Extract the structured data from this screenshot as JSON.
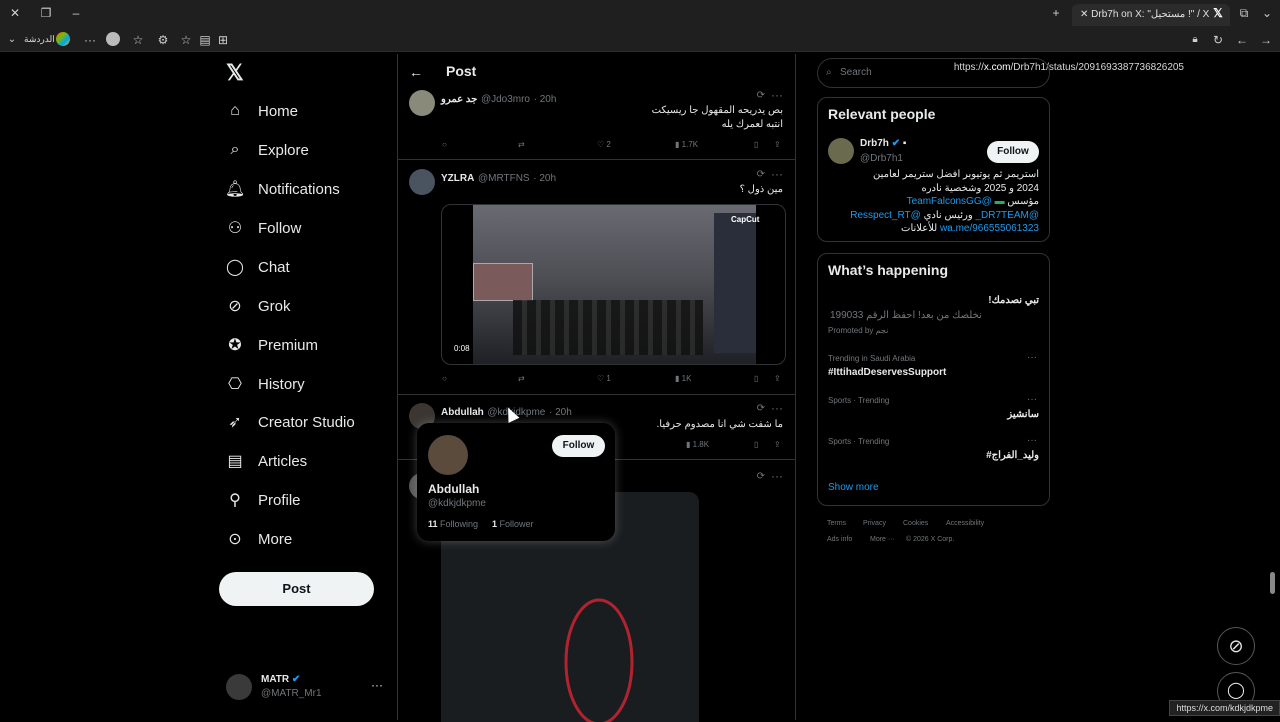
{
  "browser": {
    "tab_title": "Drb7h on X: \"مستحيل !\" / X",
    "url_prefix": "https://",
    "url_domain": "x.com",
    "url_path": "/Drb7h1/status/2091693387736826205",
    "left_chat_label": "الدردشة",
    "status_url": "https://x.com/kdkjdkpme"
  },
  "nav": {
    "items": [
      {
        "label": "Home",
        "icon": "home-icon"
      },
      {
        "label": "Explore",
        "icon": "search-icon"
      },
      {
        "label": "Notifications",
        "icon": "bell-icon"
      },
      {
        "label": "Follow",
        "icon": "person-add-icon"
      },
      {
        "label": "Chat",
        "icon": "chat-bubble-icon"
      },
      {
        "label": "Grok",
        "icon": "grok-icon"
      },
      {
        "label": "Premium",
        "icon": "verified-badge-icon"
      },
      {
        "label": "History",
        "icon": "bookmark-icon"
      },
      {
        "label": "Creator Studio",
        "icon": "rocket-icon"
      },
      {
        "label": "Articles",
        "icon": "articles-icon"
      },
      {
        "label": "Profile",
        "icon": "person-icon"
      },
      {
        "label": "More",
        "icon": "more-circle-icon"
      }
    ],
    "post_label": "Post",
    "account": {
      "name": "MATR",
      "handle": "@MATR_Mr1"
    }
  },
  "header": {
    "title": "Post"
  },
  "tweets": [
    {
      "name": "جد عمرو",
      "handle": "@Jdo3mro",
      "time": "· 20h",
      "line1": "بص يدريحه المقهول جا ريسيكت",
      "line2": "انتبه لعمرك يله",
      "likes": "2",
      "views": "1.7K"
    },
    {
      "name": "YZLRA",
      "handle": "@MRTFNS",
      "time": "· 20h",
      "line1": "مين ذول ؟",
      "video_time": "0:08",
      "watermark": "CapCut",
      "likes": "1",
      "views": "1K"
    },
    {
      "name": "Abdullah",
      "handle": "@kdkjdkpme",
      "time": "· 20h",
      "line1": "ما شفت شي انا مصدوم حرفيا.",
      "views": "1.8K"
    }
  ],
  "hovercard": {
    "name": "Abdullah",
    "handle": "@kdkjdkpme",
    "following_count": "11",
    "following_label": "Following",
    "followers_count": "1",
    "followers_label": "Follower",
    "follow_label": "Follow"
  },
  "right": {
    "search_placeholder": "Search",
    "relevant": {
      "title": "Relevant people",
      "name": "Drb7h",
      "handle": "@Drb7h1",
      "follow_label": "Follow",
      "bio1": "استريمر ثم يوتيوبر افضل ستريمر لعامين",
      "bio2": "2024 و 2025 وشخصية نادره",
      "bio3a": "مؤسس",
      "bio3b": "@TeamFalconsGG",
      "bio4a": "@DR7TEAM_",
      "bio4b": "ورئيس نادي",
      "bio4c": "@Resspect_RT",
      "bio5a": "wa.me/966555061323",
      "bio5b": "للأعلانات"
    },
    "happening": {
      "title": "What’s happening",
      "promo_title": "تبي نصدمك!",
      "promo_sub": "نخلصك من بعد! احفظ الرقم 199033",
      "promo_by": "Promoted by نجم",
      "trends": [
        {
          "cat": "Trending in Saudi Arabia",
          "name": "#IttihadDeservesSupport"
        },
        {
          "cat": "Sports · Trending",
          "name": "سانشيز"
        },
        {
          "cat": "Sports · Trending",
          "name": "#وليد_الفراج"
        }
      ],
      "show_more": "Show more"
    },
    "footer": [
      "Terms",
      "Privacy",
      "Cookies",
      "Accessibility",
      "Ads info",
      "More ···",
      "© 2026 X Corp."
    ]
  },
  "colors": {
    "accent": "#1d9bf0",
    "bg": "#000000",
    "border": "#2f3336",
    "muted": "#71767b"
  }
}
